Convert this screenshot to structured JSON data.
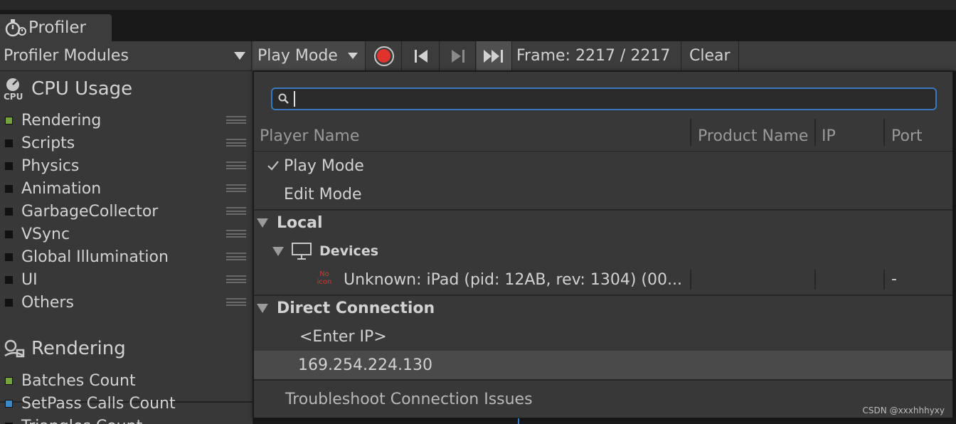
{
  "window": {
    "tab_title": "Profiler"
  },
  "toolbar": {
    "modules_label": "Profiler Modules",
    "target_label": "Play Mode",
    "frame_label": "Frame: 2217 / 2217",
    "clear_label": "Clear",
    "record_color": "#e0332e"
  },
  "sidebar": {
    "cpu_title": "CPU Usage",
    "cpu_icon_text": "CPU",
    "cpu_items": [
      {
        "label": "Rendering",
        "color": "#77a33e"
      },
      {
        "label": "Scripts",
        "color": "#111111"
      },
      {
        "label": "Physics",
        "color": "#111111"
      },
      {
        "label": "Animation",
        "color": "#111111"
      },
      {
        "label": "GarbageCollector",
        "color": "#111111"
      },
      {
        "label": "VSync",
        "color": "#111111"
      },
      {
        "label": "Global Illumination",
        "color": "#111111"
      },
      {
        "label": "UI",
        "color": "#111111"
      },
      {
        "label": "Others",
        "color": "#111111"
      }
    ],
    "render_title": "Rendering",
    "render_items": [
      {
        "label": "Batches Count",
        "color": "#77a33e"
      },
      {
        "label": "SetPass Calls Count",
        "color": "#3b88c4"
      },
      {
        "label": "Triangles Count",
        "color": "#111111"
      }
    ]
  },
  "popup": {
    "search": {
      "value": "",
      "placeholder": ""
    },
    "columns": {
      "player": "Player Name",
      "product": "Product Name",
      "ip": "IP",
      "port": "Port"
    },
    "modes": {
      "play": "Play Mode",
      "edit": "Edit Mode"
    },
    "local_label": "Local",
    "devices_label": "Devices",
    "no_icon_text": "No icon",
    "device_name": "Unknown: iPad (pid: 12AB, rev: 1304) (00...",
    "device_port": "-",
    "direct_label": "Direct Connection",
    "enter_ip": "<Enter IP>",
    "ip_entry": "169.254.224.130",
    "troubleshoot": "Troubleshoot Connection Issues"
  },
  "watermark": "CSDN @xxxhhhyxy"
}
